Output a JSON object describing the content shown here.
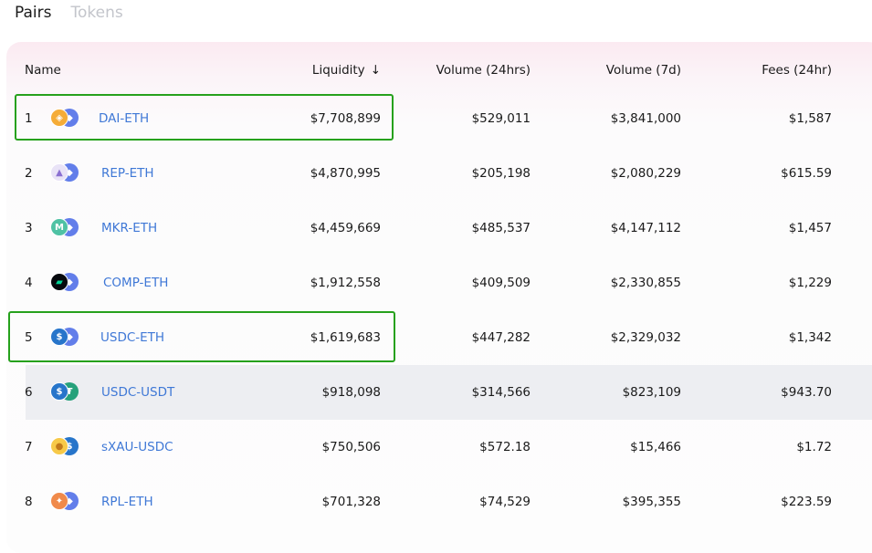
{
  "tabs": [
    {
      "label": "Pairs",
      "active": true
    },
    {
      "label": "Tokens",
      "active": false
    }
  ],
  "table": {
    "headers": {
      "name": "Name",
      "liquidity": "Liquidity",
      "sort_icon": "↓",
      "volume_24h": "Volume (24hrs)",
      "volume_7d": "Volume (7d)",
      "fees_24h": "Fees (24hr)"
    },
    "rows": [
      {
        "rank": "1",
        "pair": "DAI-ETH",
        "liquidity": "$7,708,899",
        "volume_24h": "$529,011",
        "volume_7d": "$3,841,000",
        "fees_24h": "$1,587",
        "icon_a": "dai-icon",
        "icon_b": "eth-icon"
      },
      {
        "rank": "2",
        "pair": "REP-ETH",
        "liquidity": "$4,870,995",
        "volume_24h": "$205,198",
        "volume_7d": "$2,080,229",
        "fees_24h": "$615.59",
        "icon_a": "rep-icon",
        "icon_b": "eth-icon"
      },
      {
        "rank": "3",
        "pair": "MKR-ETH",
        "liquidity": "$4,459,669",
        "volume_24h": "$485,537",
        "volume_7d": "$4,147,112",
        "fees_24h": "$1,457",
        "icon_a": "mkr-icon",
        "icon_b": "eth-icon"
      },
      {
        "rank": "4",
        "pair": "COMP-ETH",
        "liquidity": "$1,912,558",
        "volume_24h": "$409,509",
        "volume_7d": "$2,330,855",
        "fees_24h": "$1,229",
        "icon_a": "comp-icon",
        "icon_b": "eth-icon"
      },
      {
        "rank": "5",
        "pair": "USDC-ETH",
        "liquidity": "$1,619,683",
        "volume_24h": "$447,282",
        "volume_7d": "$2,329,032",
        "fees_24h": "$1,342",
        "icon_a": "usdc-icon",
        "icon_b": "eth-icon"
      },
      {
        "rank": "6",
        "pair": "USDC-USDT",
        "liquidity": "$918,098",
        "volume_24h": "$314,566",
        "volume_7d": "$823,109",
        "fees_24h": "$943.70",
        "icon_a": "usdc-icon",
        "icon_b": "usdt-icon"
      },
      {
        "rank": "7",
        "pair": "sXAU-USDC",
        "liquidity": "$750,506",
        "volume_24h": "$572.18",
        "volume_7d": "$15,466",
        "fees_24h": "$1.72",
        "icon_a": "sxau-icon",
        "icon_b": "usdc-icon"
      },
      {
        "rank": "8",
        "pair": "RPL-ETH",
        "liquidity": "$701,328",
        "volume_24h": "$74,529",
        "volume_7d": "$395,355",
        "fees_24h": "$223.59",
        "icon_a": "rpl-icon",
        "icon_b": "eth-icon"
      }
    ]
  },
  "colors": {
    "link": "#3f78d6",
    "highlight_row": "#edeef2",
    "annotation_box": "#26a11c",
    "eth": "#627eea",
    "dai": "#f5ac37",
    "rep": "#e9e3f7",
    "mkr": "#4fc2a4",
    "comp": "#070a0e",
    "usdc": "#2775ca",
    "usdt": "#26a17b",
    "sxau": "#f7c948",
    "rpl": "#f08a4b"
  }
}
